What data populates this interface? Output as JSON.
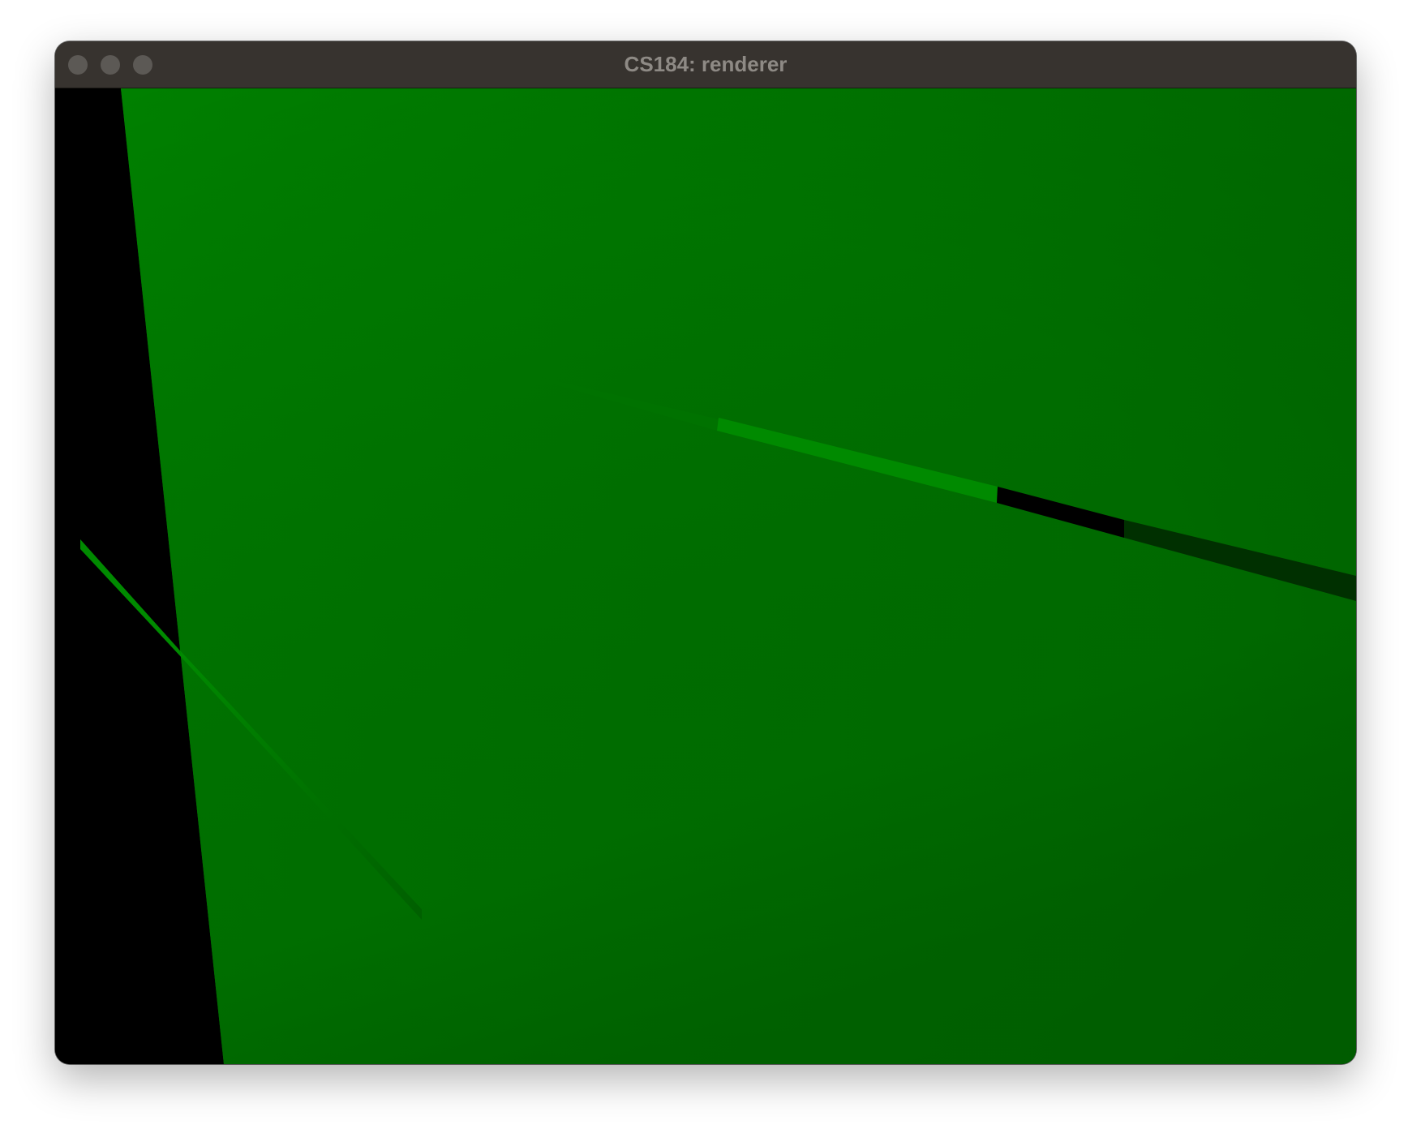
{
  "window": {
    "title": "CS184: renderer",
    "traffic_lights": [
      "close-icon",
      "minimize-icon",
      "zoom-icon"
    ]
  },
  "scene": {
    "background_color": "#000000",
    "plane_color_bright": "#008200",
    "plane_color_mid": "#007800",
    "plane_color_dark": "#006400",
    "edge_segment_colors": [
      "#007000",
      "#008a00",
      "#000000",
      "#003000"
    ],
    "diagonal_line_colors": [
      "#008a00",
      "#005f00"
    ]
  }
}
